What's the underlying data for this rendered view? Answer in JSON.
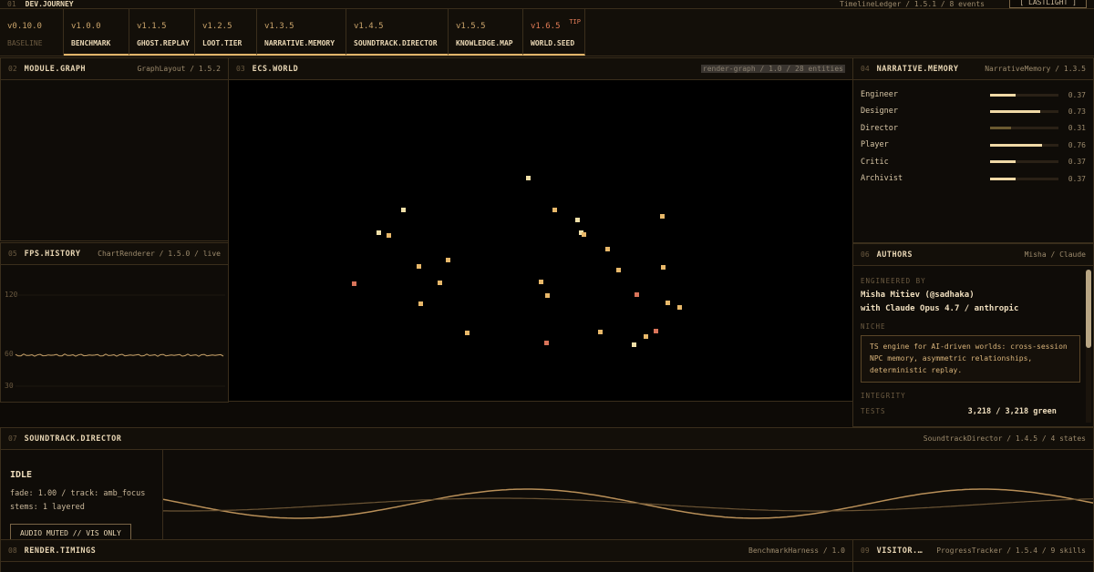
{
  "topbar": {
    "num": "01",
    "title": "DEV.JOURNEY",
    "ledger": "TimelineLedger / 1.5.1 / 8 events",
    "theme_button": "[ LASTLIGHT ]"
  },
  "tabs": [
    {
      "ver": "v0.10.0",
      "name": "BASELINE"
    },
    {
      "ver": "v1.0.0",
      "name": "BENCHMARK"
    },
    {
      "ver": "v1.1.5",
      "name": "GHOST.REPLAY"
    },
    {
      "ver": "v1.2.5",
      "name": "LOOT.TIER"
    },
    {
      "ver": "v1.3.5",
      "name": "NARRATIVE.MEMORY"
    },
    {
      "ver": "v1.4.5",
      "name": "SOUNDTRACK.DIRECTOR"
    },
    {
      "ver": "v1.5.5",
      "name": "KNOWLEDGE.MAP"
    },
    {
      "ver": "v1.6.5",
      "name": "WORLD.SEED",
      "tip": "TIP"
    }
  ],
  "module_graph": {
    "num": "02",
    "title": "MODULE.GRAPH",
    "meta": "GraphLayout / 1.5.2"
  },
  "ecs_world": {
    "num": "03",
    "title": "ECS.WORLD",
    "meta": "render-graph / 1.0 / 28 entities"
  },
  "narrative_memory": {
    "num": "04",
    "title": "NARRATIVE.MEMORY",
    "meta": "NarrativeMemory / 1.3.5",
    "rows": [
      {
        "name": "Engineer",
        "value": 0.37,
        "label": "0.37"
      },
      {
        "name": "Designer",
        "value": 0.73,
        "label": "0.73"
      },
      {
        "name": "Director",
        "value": 0.31,
        "label": "0.31",
        "dim": true
      },
      {
        "name": "Player",
        "value": 0.76,
        "label": "0.76"
      },
      {
        "name": "Critic",
        "value": 0.37,
        "label": "0.37"
      },
      {
        "name": "Archivist",
        "value": 0.37,
        "label": "0.37"
      }
    ]
  },
  "fps_history": {
    "num": "05",
    "title": "FPS.HISTORY",
    "meta": "ChartRenderer / 1.5.0 / live",
    "ticks": [
      "120",
      "60",
      "30"
    ]
  },
  "authors": {
    "num": "06",
    "title": "AUTHORS",
    "meta": "Misha / Claude",
    "engineered_label": "ENGINEERED BY",
    "author_line": "Misha Mitiev (@sadhaka)",
    "with_line": "with Claude Opus 4.7 / anthropic",
    "niche_label": "NICHE",
    "niche_text": "TS engine for AI-driven worlds: cross-session NPC memory, asymmetric relationships, deterministic replay.",
    "integrity_label": "INTEGRITY",
    "tests_label": "TESTS",
    "tests_value": "3,218 / 3,218 green"
  },
  "soundtrack": {
    "num": "07",
    "title": "SOUNDTRACK.DIRECTOR",
    "meta": "SoundtrackDirector / 1.4.5 / 4 states",
    "state": "IDLE",
    "fade_line": "fade: 1.00 / track: amb_focus",
    "stems_line": "stems: 1 layered",
    "mute_button": "AUDIO MUTED // VIS ONLY"
  },
  "render_timings": {
    "num": "08",
    "title": "RENDER.TIMINGS",
    "meta": "BenchmarkHarness / 1.0"
  },
  "visitor": {
    "num": "09",
    "title": "VISITOR.…",
    "meta": "ProgressTracker / 1.5.4 / 9 skills"
  },
  "colors": {
    "accent": "#e0b46a",
    "entity_light": "#f0dfa8",
    "entity_warm": "#e8b86a",
    "entity_red": "#d9745a"
  }
}
